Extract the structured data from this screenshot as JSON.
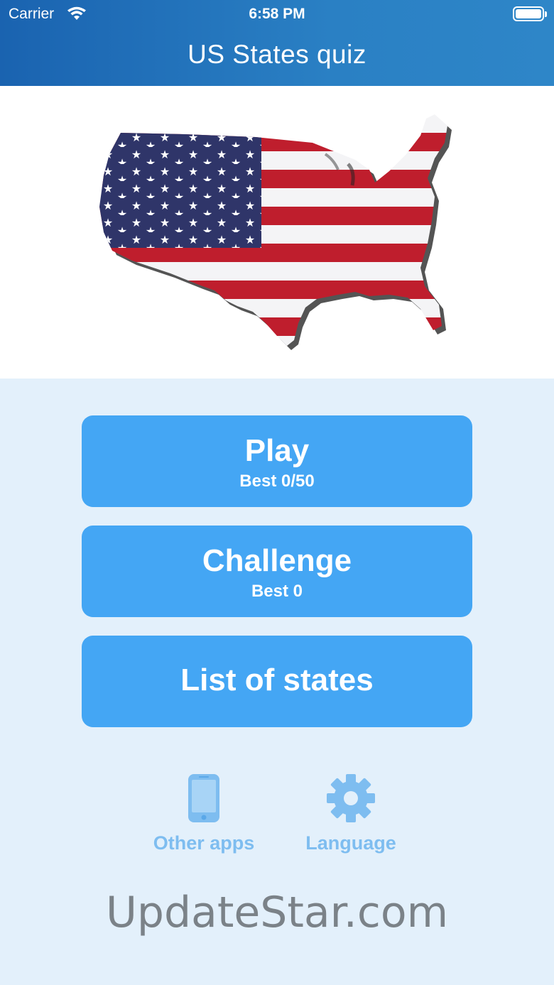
{
  "status_bar": {
    "carrier": "Carrier",
    "time": "6:58 PM",
    "wifi_icon": "wifi-icon",
    "battery_icon": "battery-icon"
  },
  "nav": {
    "title": "US States quiz"
  },
  "hero": {
    "image_icon": "us-flag-map-icon"
  },
  "menu": {
    "play": {
      "label": "Play",
      "best": "Best 0/50"
    },
    "challenge": {
      "label": "Challenge",
      "best": "Best 0"
    },
    "list": {
      "label": "List of states"
    }
  },
  "utilities": {
    "other_apps": {
      "label": "Other apps",
      "icon": "phone-icon"
    },
    "language": {
      "label": "Language",
      "icon": "gear-icon"
    }
  },
  "watermark": {
    "text": "UpdateStar.com"
  },
  "colors": {
    "nav_bar": "#1a63b0",
    "button": "#44a6f4",
    "background": "#e3f0fb",
    "utility": "#7ebdf0",
    "flag_red": "#bf1e2d",
    "flag_blue": "#2f3569"
  }
}
